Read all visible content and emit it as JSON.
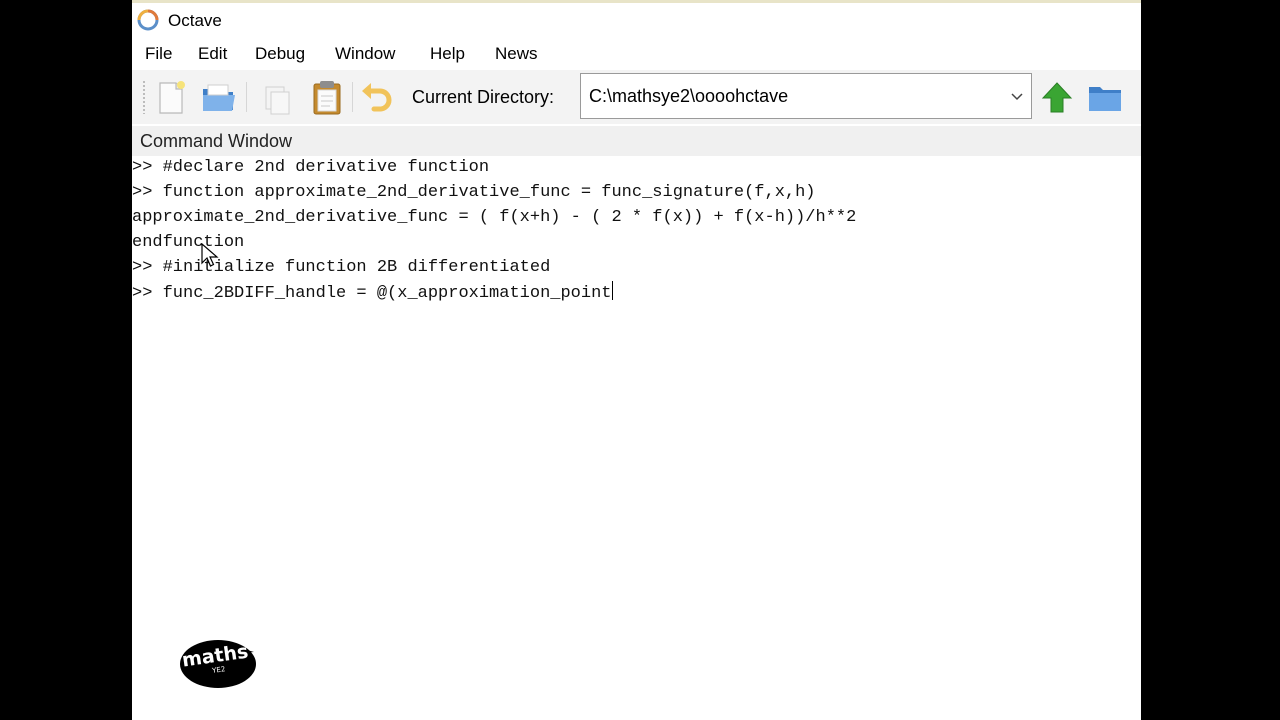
{
  "window": {
    "title": "Octave"
  },
  "menu": {
    "items": [
      "File",
      "Edit",
      "Debug",
      "Window",
      "Help",
      "News"
    ]
  },
  "toolbar": {
    "buttons": [
      "new-script-icon",
      "open-folder-icon",
      "copy-icon",
      "paste-icon",
      "undo-icon"
    ],
    "current_directory_label": "Current Directory:",
    "current_directory_value": "C:\\mathsye2\\oooohctave",
    "up_icon": "arrow-up-icon",
    "browse_icon": "folder-icon"
  },
  "command_window": {
    "title": "Command Window",
    "lines": [
      ">> #declare 2nd derivative function",
      ">> function approximate_2nd_derivative_func = func_signature(f,x,h)",
      "approximate_2nd_derivative_func = ( f(x+h) - ( 2 * f(x)) + f(x-h))/h**2",
      "endfunction",
      ">> #initialize function 2B differentiated",
      ">> func_2BDIFF_handle = @(x_approximation_point"
    ]
  },
  "watermark": {
    "text_top": "maths",
    "text_bottom": "YE2"
  },
  "colors": {
    "toolbar_bg": "#f3f3f3",
    "header_bg": "#f0f0f0",
    "arrow_green": "#3aa533",
    "folder_blue": "#4a8fd8"
  }
}
